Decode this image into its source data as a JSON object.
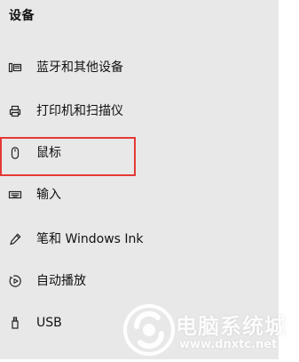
{
  "section": {
    "title": "设备"
  },
  "nav_items": [
    {
      "label": "蓝牙和其他设备",
      "icon": "bluetooth-devices-icon"
    },
    {
      "label": "打印机和扫描仪",
      "icon": "printer-icon"
    },
    {
      "label": "鼠标",
      "icon": "mouse-icon"
    },
    {
      "label": "输入",
      "icon": "keyboard-icon"
    },
    {
      "label": "笔和 Windows Ink",
      "icon": "pen-icon"
    },
    {
      "label": "自动播放",
      "icon": "autoplay-icon"
    },
    {
      "label": "USB",
      "icon": "usb-icon"
    }
  ],
  "annotation": {
    "highlight_color": "#e53935"
  },
  "watermark": {
    "text": "电脑系统城",
    "url": "www.dnxtc.net"
  }
}
